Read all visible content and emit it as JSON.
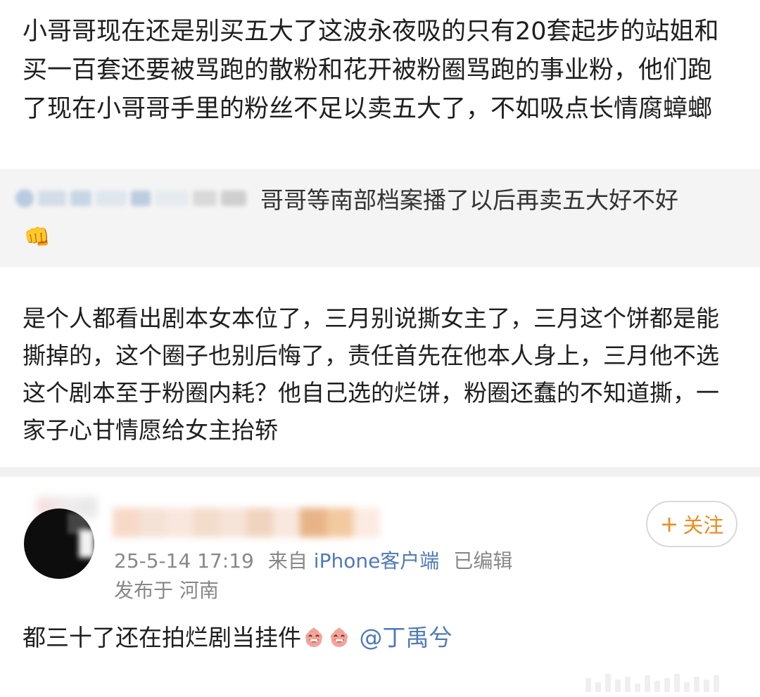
{
  "post": {
    "text": "小哥哥现在还是别买五大了这波永夜吸的只有20套起步的站姐和买一百套还要被骂跑的散粉和花开被粉圈骂跑的事业粉，他们跑了现在小哥哥手里的粉丝不足以卖五大了，不如吸点长情腐蟑螂"
  },
  "quote": {
    "text": "哥哥等南部档案播了以后再卖五大好不好",
    "emoji_icon": "fist-emoji",
    "emoji_char": "👊"
  },
  "reply": {
    "text": "是个人都看出剧本女本位了，三月别说撕女主了，三月这个饼都是能撕掉的，这个圈子也别后悔了，责任首先在他本人身上，三月他不选这个剧本至于粉圈内耗？他自己选的烂饼，粉圈还蠢的不知道撕，一家子心甘情愿给女主抬轿"
  },
  "comment": {
    "follow_plus": "+",
    "follow_label": "关注",
    "timestamp": "25-5-14 17:19",
    "source_prefix": "来自",
    "source": "iPhone客户端",
    "edited": "已编辑",
    "location": "发布于 河南",
    "text": "都三十了还在拍烂剧当挂件",
    "mention": "@丁禹兮",
    "emoji_icon": "laughing-face-emoji"
  },
  "colors": {
    "accent_orange": "#f08a1d",
    "link_blue": "#4f7ab8",
    "meta_gray": "#888888"
  }
}
